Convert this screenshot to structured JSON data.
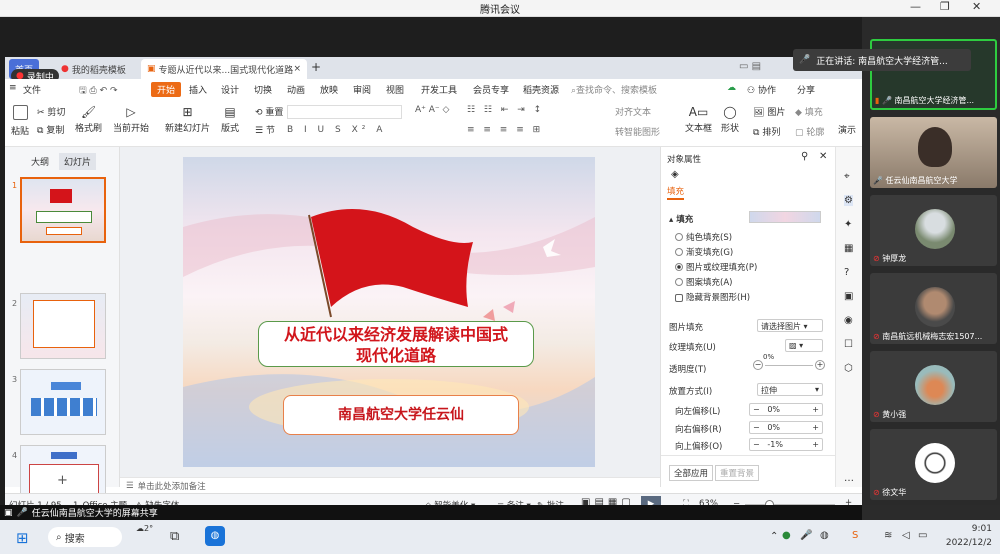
{
  "meeting": {
    "title": "腾讯会议",
    "speaking": "正在讲话: 南昌航空大学经济管...",
    "recording": "录制中",
    "share_status": "任云仙南昌航空大学的屏幕共享"
  },
  "wps": {
    "tabs": [
      "首页",
      "我的稻壳模板",
      "专题从近代以来...国式现代化道路"
    ],
    "menu": [
      "文件",
      "开始",
      "插入",
      "设计",
      "切换",
      "动画",
      "放映",
      "审阅",
      "视图",
      "开发工具",
      "会员专享",
      "稻壳资源"
    ],
    "search_placeholder": "查找命令、搜索模板",
    "collab": "协作",
    "share": "分享",
    "ribbon": {
      "paste": "粘贴",
      "cut": "剪切",
      "copy": "复制",
      "format_painter": "格式刷",
      "from_current": "当前开始",
      "new_slide": "新建幻灯片",
      "layout": "版式",
      "section": "节",
      "reset": "重置",
      "align_text": "对齐文本",
      "smart_graphic": "转智能图形",
      "textbox": "文本框",
      "shape": "形状",
      "arrange": "排列",
      "picture": "图片",
      "fill": "填充",
      "outline": "轮廓",
      "slideshow": "演示"
    },
    "view_tabs": [
      "大纲",
      "幻灯片"
    ],
    "slide_numbers": [
      "1",
      "2",
      "3",
      "4"
    ],
    "slide": {
      "title_line1": "从近代以来经济发展解读中国式",
      "title_line2": "现代化道路",
      "subtitle": "南昌航空大学任云仙"
    },
    "notes_placeholder": "单击此处添加备注",
    "status": {
      "slide_count": "幻灯片 1 / 95",
      "theme": "1_Office 主题",
      "missing_font": "缺失字体",
      "beautify": "智能美化",
      "notes": "备注",
      "comments": "批注",
      "zoom": "63%"
    },
    "props": {
      "title": "对象属性",
      "tab": "填充",
      "section": "填充",
      "options": [
        "纯色填充(S)",
        "渐变填充(G)",
        "图片或纹理填充(P)",
        "图案填充(A)"
      ],
      "hide_bg": "隐藏背景图形(H)",
      "picture_fill_label": "图片填充",
      "picture_fill_value": "请选择图片",
      "texture_label": "纹理填充(U)",
      "transparency_label": "透明度(T)",
      "transparency_value": "0%",
      "placement_label": "放置方式(I)",
      "placement_value": "拉伸",
      "left_offset_label": "向左偏移(L)",
      "left_offset_value": "0%",
      "right_offset_label": "向右偏移(R)",
      "right_offset_value": "0%",
      "up_offset_label": "向上偏移(O)",
      "up_offset_value": "-1%",
      "apply_all": "全部应用",
      "reset_bg": "重置背景"
    }
  },
  "participants": [
    "南昌航空大学经济管...",
    "任云仙南昌航空大学",
    "钟厚龙",
    "南昌航远机械梅志宏1507...",
    "黄小强",
    "徐文华"
  ],
  "taskbar": {
    "search": "搜索",
    "temp": "2°",
    "time": "9:01",
    "date": "2022/12/2"
  }
}
